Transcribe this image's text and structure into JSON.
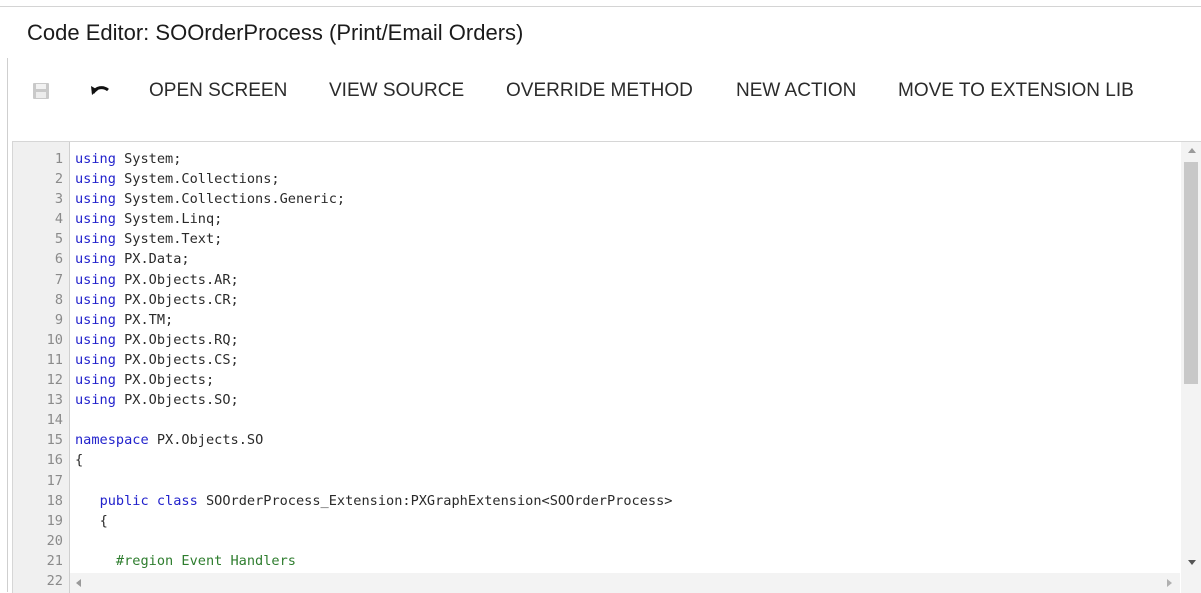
{
  "title": "Code Editor: SOOrderProcess (Print/Email Orders)",
  "toolbar": {
    "save_icon": "save-icon",
    "undo_icon": "undo-icon",
    "buttons": [
      {
        "label": "OPEN SCREEN"
      },
      {
        "label": "VIEW SOURCE"
      },
      {
        "label": "OVERRIDE METHOD"
      },
      {
        "label": "NEW ACTION"
      },
      {
        "label": "MOVE TO EXTENSION LIB"
      }
    ]
  },
  "editor": {
    "lines": [
      {
        "n": "1",
        "indent": "",
        "parts": [
          [
            "kw",
            "using"
          ],
          [
            "ns",
            " System;"
          ]
        ]
      },
      {
        "n": "2",
        "indent": "",
        "parts": [
          [
            "kw",
            "using"
          ],
          [
            "ns",
            " System.Collections;"
          ]
        ]
      },
      {
        "n": "3",
        "indent": "",
        "parts": [
          [
            "kw",
            "using"
          ],
          [
            "ns",
            " System.Collections.Generic;"
          ]
        ]
      },
      {
        "n": "4",
        "indent": "",
        "parts": [
          [
            "kw",
            "using"
          ],
          [
            "ns",
            " System.Linq;"
          ]
        ]
      },
      {
        "n": "5",
        "indent": "",
        "parts": [
          [
            "kw",
            "using"
          ],
          [
            "ns",
            " System.Text;"
          ]
        ]
      },
      {
        "n": "6",
        "indent": "",
        "parts": [
          [
            "kw",
            "using"
          ],
          [
            "ns",
            " PX.Data;"
          ]
        ]
      },
      {
        "n": "7",
        "indent": "",
        "parts": [
          [
            "kw",
            "using"
          ],
          [
            "ns",
            " PX.Objects.AR;"
          ]
        ]
      },
      {
        "n": "8",
        "indent": "",
        "parts": [
          [
            "kw",
            "using"
          ],
          [
            "ns",
            " PX.Objects.CR;"
          ]
        ]
      },
      {
        "n": "9",
        "indent": "",
        "parts": [
          [
            "kw",
            "using"
          ],
          [
            "ns",
            " PX.TM;"
          ]
        ]
      },
      {
        "n": "10",
        "indent": "",
        "parts": [
          [
            "kw",
            "using"
          ],
          [
            "ns",
            " PX.Objects.RQ;"
          ]
        ]
      },
      {
        "n": "11",
        "indent": "",
        "parts": [
          [
            "kw",
            "using"
          ],
          [
            "ns",
            " PX.Objects.CS;"
          ]
        ]
      },
      {
        "n": "12",
        "indent": "",
        "parts": [
          [
            "kw",
            "using"
          ],
          [
            "ns",
            " PX.Objects;"
          ]
        ]
      },
      {
        "n": "13",
        "indent": "",
        "parts": [
          [
            "kw",
            "using"
          ],
          [
            "ns",
            " PX.Objects.SO;"
          ]
        ]
      },
      {
        "n": "14",
        "indent": "",
        "parts": []
      },
      {
        "n": "15",
        "indent": "",
        "parts": [
          [
            "kw",
            "namespace"
          ],
          [
            "ns",
            " PX.Objects.SO"
          ]
        ]
      },
      {
        "n": "16",
        "indent": "",
        "parts": [
          [
            "ns",
            "{"
          ]
        ]
      },
      {
        "n": "17",
        "indent": "",
        "parts": []
      },
      {
        "n": "18",
        "indent": "   ",
        "parts": [
          [
            "kw",
            "public"
          ],
          [
            "ns",
            " "
          ],
          [
            "kw",
            "class"
          ],
          [
            "ns",
            " SOOrderProcess_Extension:PXGraphExtension<SOOrderProcess>"
          ]
        ]
      },
      {
        "n": "19",
        "indent": "   ",
        "parts": [
          [
            "ns",
            "{"
          ]
        ]
      },
      {
        "n": "20",
        "indent": "",
        "parts": []
      },
      {
        "n": "21",
        "indent": "     ",
        "parts": [
          [
            "cmt",
            "#region Event Handlers"
          ]
        ]
      },
      {
        "n": "22",
        "indent": "",
        "parts": []
      }
    ]
  }
}
